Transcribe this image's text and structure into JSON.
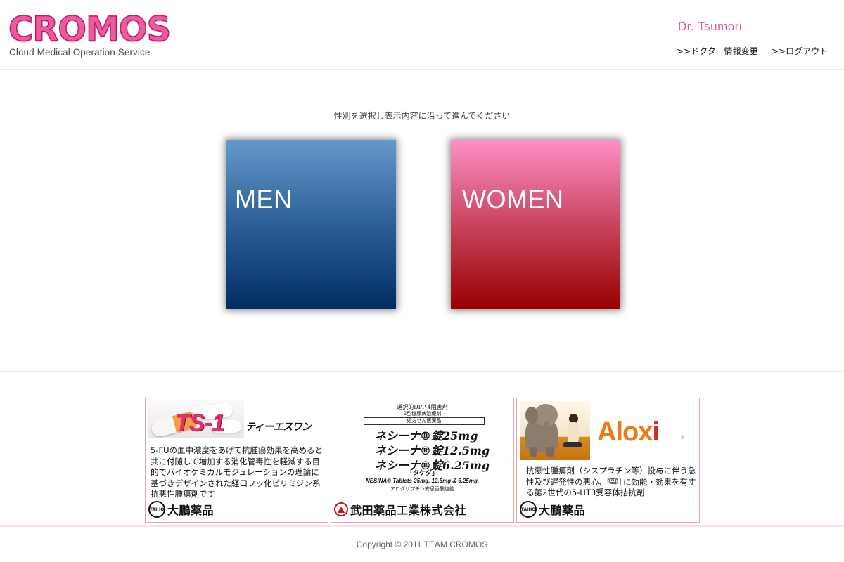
{
  "header": {
    "logo_word": "CROMOS",
    "logo_subtitle": "Cloud Medical Operation Service",
    "doctor_name": "Dr. Tsumori",
    "links": {
      "edit_doctor_info": ">>ドクター情報変更",
      "logout": ">>ログアウト"
    }
  },
  "main": {
    "instruction": "性別を選択し表示内容に沿って進んでください",
    "tiles": {
      "men": "MEN",
      "women": "WOMEN"
    }
  },
  "ads": {
    "ts1": {
      "product_logo": "TS-1",
      "product_kana": "ティーエスワン",
      "description": "5-FUの血中濃度をあげて抗腫瘍効果を高めると共に付随して増加する消化管毒性を軽減する目的でバイオケミカルモジュレーションの理論に基づきデザインされた経口フッ化ピリミジン系抗悪性腫瘍剤です",
      "company_mark": "TAIHO",
      "company": "大鵬薬品"
    },
    "nesina": {
      "category": "選択的DPP-4阻害剤",
      "indication": "― 2型糖尿病治療剤 ―",
      "rx_note": "処方せん医薬品",
      "doses": [
        "ネシーナ®錠25mg",
        "ネシーナ®錠12.5mg",
        "ネシーナ®錠6.25mg"
      ],
      "takeda": "「タケダ」",
      "tablets": "NESINA® Tablets 25mg, 12.5mg & 6.25mg.",
      "generic": "アログリプチン安息香酸塩錠",
      "company": "武田薬品工業株式会社"
    },
    "aloxi": {
      "product_logo_main": "Alox",
      "product_logo_i": "i",
      "product_reg": "®",
      "description": "抗悪性腫瘍剤（シスプラチン等）投与に伴う急性及び遅発性の悪心、嘔吐に効能・効果を有する第2世代の5-HT3受容体拮抗剤",
      "company_mark": "TAIHO",
      "company": "大鵬薬品"
    }
  },
  "footer": {
    "copyright": "Copyright © 2011 TEAM CROMOS"
  },
  "colors": {
    "brand_pink": "#ec5aa0",
    "men_gradient_top": "#6599cb",
    "men_gradient_bottom": "#002e62",
    "women_gradient_top": "#ff8fc8",
    "women_gradient_bottom": "#990000",
    "divider": "#fbe3ee"
  }
}
